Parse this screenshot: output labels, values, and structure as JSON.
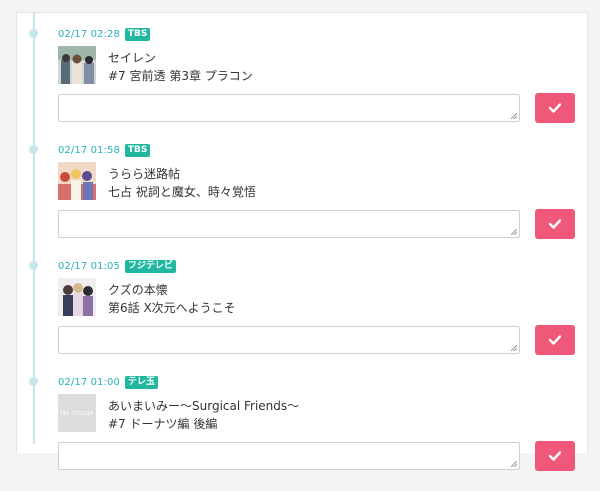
{
  "entries": [
    {
      "time": "02/17 02:28",
      "channel": "TBS",
      "title": "セイレン",
      "episode": "#7  宮前透 第3章 プラコン",
      "thumb": "image"
    },
    {
      "time": "02/17 01:58",
      "channel": "TBS",
      "title": "うらら迷路帖",
      "episode": "七占  祝詞と魔女、時々覚悟",
      "thumb": "image"
    },
    {
      "time": "02/17 01:05",
      "channel": "フジテレビ",
      "title": "クズの本懐",
      "episode": "第6話  X次元へようこそ",
      "thumb": "image"
    },
    {
      "time": "02/17 01:00",
      "channel": "テレ玉",
      "title": "あいまいみー～Surgical Friends～",
      "episode": "#7  ドーナツ編 後編",
      "thumb": "none",
      "thumb_label": "No Image"
    }
  ],
  "submit_icon": "check-icon",
  "colors": {
    "accent": "#2ab3b8",
    "badge": "#22b8a0",
    "submit": "#f0587a",
    "timeline": "#c7e6ea"
  }
}
